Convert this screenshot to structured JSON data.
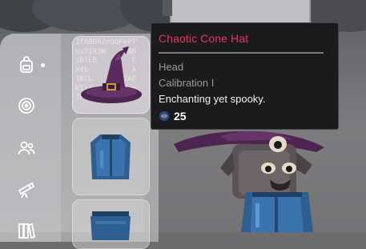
{
  "tooltip": {
    "title": "Chaotic Cone Hat",
    "slot": "Head",
    "calibration": "Calibration I",
    "description": "Enchanting yet spooky.",
    "cost": "25",
    "cost_icon": "crystal-orb-icon",
    "title_color": "#e8345f"
  },
  "sidebar": {
    "items": [
      {
        "name": "backpack-icon",
        "active": true
      },
      {
        "name": "target-icon"
      },
      {
        "name": "friends-icon"
      },
      {
        "name": "telescope-icon"
      },
      {
        "name": "books-icon"
      }
    ]
  },
  "inventory": {
    "selected_slot_code": "JfA0DRZoOQFePT\nus7IR3W     4H\nsDTLB        F\nX4b          A\n1KCL   -   ZAE\nKIlILW    HM o\nJFB5sdZH9amFU"
  },
  "colors": {
    "hat": "#5a2a5c",
    "shirt": "#3a6fa8"
  }
}
